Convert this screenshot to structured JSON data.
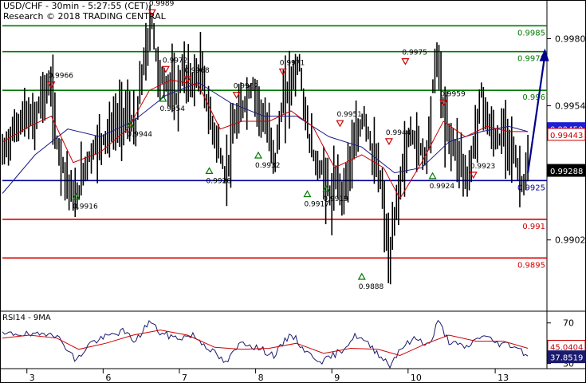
{
  "header": {
    "title": "USD/CHF - 30min - 5:27:55 (CET)",
    "copyright": "Research © 2018 TRADING CENTRAL"
  },
  "colors": {
    "candles": "#000000",
    "ma_fast": "#cc0000",
    "ma_slow": "#1a1a8c",
    "resistance": "#007a00",
    "support_blue": "#00009a",
    "support_red": "#d40000",
    "forecast_arrow": "#00008b",
    "price_label_blue": "#1f1fd6",
    "price_label_red": "#cc0000",
    "rsi_line": "#1a1a6e",
    "rsi_ma": "#cc0000",
    "up_marker": "#007a00",
    "down_marker": "#cc0000"
  },
  "chart_data": [
    {
      "type": "line",
      "name": "price",
      "ylim": [
        0.9875,
        0.9995
      ],
      "y_ticks": [
        "0.9980",
        "0.9954",
        "0.9928",
        "0.9902"
      ],
      "x_ticks": [
        "3",
        "6",
        "7",
        "8",
        "9",
        "10",
        "13"
      ],
      "price_path": [
        {
          "t": 0.0,
          "v": 0.9935
        },
        {
          "t": 0.02,
          "v": 0.9944
        },
        {
          "t": 0.04,
          "v": 0.995
        },
        {
          "t": 0.06,
          "v": 0.9948
        },
        {
          "t": 0.07,
          "v": 0.9957
        },
        {
          "t": 0.09,
          "v": 0.9962
        },
        {
          "t": 0.1,
          "v": 0.994
        },
        {
          "t": 0.12,
          "v": 0.9925
        },
        {
          "t": 0.135,
          "v": 0.9916
        },
        {
          "t": 0.15,
          "v": 0.993
        },
        {
          "t": 0.17,
          "v": 0.9938
        },
        {
          "t": 0.19,
          "v": 0.9942
        },
        {
          "t": 0.21,
          "v": 0.9948
        },
        {
          "t": 0.23,
          "v": 0.9951
        },
        {
          "t": 0.245,
          "v": 0.9944
        },
        {
          "t": 0.255,
          "v": 0.9965
        },
        {
          "t": 0.265,
          "v": 0.9975
        },
        {
          "t": 0.275,
          "v": 0.9988
        },
        {
          "t": 0.285,
          "v": 0.9968
        },
        {
          "t": 0.3,
          "v": 0.9962
        },
        {
          "t": 0.31,
          "v": 0.9962
        },
        {
          "t": 0.32,
          "v": 0.9956
        },
        {
          "t": 0.33,
          "v": 0.9967
        },
        {
          "t": 0.35,
          "v": 0.9963
        },
        {
          "t": 0.365,
          "v": 0.9968
        },
        {
          "t": 0.38,
          "v": 0.995
        },
        {
          "t": 0.395,
          "v": 0.994
        },
        {
          "t": 0.41,
          "v": 0.9926
        },
        {
          "t": 0.425,
          "v": 0.9945
        },
        {
          "t": 0.445,
          "v": 0.9955
        },
        {
          "t": 0.46,
          "v": 0.9962
        },
        {
          "t": 0.48,
          "v": 0.9948
        },
        {
          "t": 0.495,
          "v": 0.994
        },
        {
          "t": 0.5,
          "v": 0.9932
        },
        {
          "t": 0.515,
          "v": 0.9955
        },
        {
          "t": 0.53,
          "v": 0.9963
        },
        {
          "t": 0.545,
          "v": 0.9971
        },
        {
          "t": 0.56,
          "v": 0.9945
        },
        {
          "t": 0.575,
          "v": 0.9932
        },
        {
          "t": 0.59,
          "v": 0.9928
        },
        {
          "t": 0.605,
          "v": 0.9917
        },
        {
          "t": 0.615,
          "v": 0.9928
        },
        {
          "t": 0.625,
          "v": 0.9919
        },
        {
          "t": 0.635,
          "v": 0.993
        },
        {
          "t": 0.65,
          "v": 0.994
        },
        {
          "t": 0.665,
          "v": 0.9951
        },
        {
          "t": 0.68,
          "v": 0.9935
        },
        {
          "t": 0.695,
          "v": 0.9925
        },
        {
          "t": 0.705,
          "v": 0.9905
        },
        {
          "t": 0.712,
          "v": 0.9892
        },
        {
          "t": 0.72,
          "v": 0.991
        },
        {
          "t": 0.735,
          "v": 0.993
        },
        {
          "t": 0.75,
          "v": 0.9944
        },
        {
          "t": 0.765,
          "v": 0.9938
        },
        {
          "t": 0.78,
          "v": 0.9935
        },
        {
          "t": 0.79,
          "v": 0.996
        },
        {
          "t": 0.8,
          "v": 0.9975
        },
        {
          "t": 0.81,
          "v": 0.995
        },
        {
          "t": 0.825,
          "v": 0.994
        },
        {
          "t": 0.84,
          "v": 0.9935
        },
        {
          "t": 0.855,
          "v": 0.9924
        },
        {
          "t": 0.87,
          "v": 0.9945
        },
        {
          "t": 0.88,
          "v": 0.9959
        },
        {
          "t": 0.895,
          "v": 0.9945
        },
        {
          "t": 0.91,
          "v": 0.994
        },
        {
          "t": 0.925,
          "v": 0.9945
        },
        {
          "t": 0.94,
          "v": 0.9935
        },
        {
          "t": 0.955,
          "v": 0.9923
        },
        {
          "t": 0.965,
          "v": 0.9929
        }
      ],
      "ma_fast_path": [
        {
          "t": 0.0,
          "v": 0.994
        },
        {
          "t": 0.05,
          "v": 0.9946
        },
        {
          "t": 0.09,
          "v": 0.995
        },
        {
          "t": 0.13,
          "v": 0.9932
        },
        {
          "t": 0.18,
          "v": 0.9936
        },
        {
          "t": 0.23,
          "v": 0.9945
        },
        {
          "t": 0.27,
          "v": 0.996
        },
        {
          "t": 0.31,
          "v": 0.9964
        },
        {
          "t": 0.36,
          "v": 0.9962
        },
        {
          "t": 0.4,
          "v": 0.9945
        },
        {
          "t": 0.44,
          "v": 0.9948
        },
        {
          "t": 0.49,
          "v": 0.9948
        },
        {
          "t": 0.53,
          "v": 0.9952
        },
        {
          "t": 0.57,
          "v": 0.9946
        },
        {
          "t": 0.61,
          "v": 0.993
        },
        {
          "t": 0.66,
          "v": 0.9935
        },
        {
          "t": 0.7,
          "v": 0.993
        },
        {
          "t": 0.73,
          "v": 0.9918
        },
        {
          "t": 0.77,
          "v": 0.9932
        },
        {
          "t": 0.81,
          "v": 0.9948
        },
        {
          "t": 0.85,
          "v": 0.9942
        },
        {
          "t": 0.89,
          "v": 0.9946
        },
        {
          "t": 0.93,
          "v": 0.9944
        },
        {
          "t": 0.965,
          "v": 0.9944
        }
      ],
      "ma_slow_path": [
        {
          "t": 0.0,
          "v": 0.992
        },
        {
          "t": 0.06,
          "v": 0.9935
        },
        {
          "t": 0.12,
          "v": 0.9945
        },
        {
          "t": 0.18,
          "v": 0.9942
        },
        {
          "t": 0.24,
          "v": 0.9948
        },
        {
          "t": 0.3,
          "v": 0.9958
        },
        {
          "t": 0.36,
          "v": 0.9963
        },
        {
          "t": 0.42,
          "v": 0.9955
        },
        {
          "t": 0.48,
          "v": 0.995
        },
        {
          "t": 0.54,
          "v": 0.995
        },
        {
          "t": 0.6,
          "v": 0.9942
        },
        {
          "t": 0.66,
          "v": 0.9938
        },
        {
          "t": 0.72,
          "v": 0.9928
        },
        {
          "t": 0.77,
          "v": 0.993
        },
        {
          "t": 0.82,
          "v": 0.994
        },
        {
          "t": 0.88,
          "v": 0.9944
        },
        {
          "t": 0.93,
          "v": 0.9946
        },
        {
          "t": 0.965,
          "v": 0.9944
        }
      ],
      "levels": [
        {
          "value": 0.9985,
          "label": "0.9985",
          "color": "#007a00"
        },
        {
          "value": 0.9975,
          "label": "0.9975",
          "color": "#007a00"
        },
        {
          "value": 0.996,
          "label": "0.996",
          "color": "#007a00"
        },
        {
          "value": 0.9925,
          "label": "0.9925",
          "color": "#00009a"
        },
        {
          "value": 0.991,
          "label": "0.991",
          "color": "#d40000"
        },
        {
          "value": 0.9895,
          "label": "0.9895",
          "color": "#d40000"
        }
      ],
      "price_labels": [
        {
          "label": "0.99450",
          "value": 0.9945,
          "color": "#1f1fd6"
        },
        {
          "label": "0.99443",
          "value": 0.99443,
          "color": "#cc0000"
        },
        {
          "label": "0.99288",
          "value": 0.99288,
          "color": "#000000"
        }
      ],
      "markers": [
        {
          "kind": "down",
          "t": 0.09,
          "v": 0.9962,
          "label": "0.9966"
        },
        {
          "kind": "down",
          "t": 0.275,
          "v": 0.999,
          "label": "0.9989"
        },
        {
          "kind": "down",
          "t": 0.3,
          "v": 0.9968,
          "label": "0.9972"
        },
        {
          "kind": "down",
          "t": 0.34,
          "v": 0.9964,
          "label": "0.9968"
        },
        {
          "kind": "down",
          "t": 0.43,
          "v": 0.9958,
          "label": "0.9962"
        },
        {
          "kind": "down",
          "t": 0.515,
          "v": 0.9967,
          "label": "0.9971"
        },
        {
          "kind": "down",
          "t": 0.62,
          "v": 0.9947,
          "label": "0.9951"
        },
        {
          "kind": "down",
          "t": 0.71,
          "v": 0.994,
          "label": "0.9944"
        },
        {
          "kind": "down",
          "t": 0.74,
          "v": 0.9971,
          "label": "0.9975"
        },
        {
          "kind": "down",
          "t": 0.81,
          "v": 0.9955,
          "label": "0.9959"
        },
        {
          "kind": "up",
          "t": 0.135,
          "v": 0.9919,
          "label": "0.9916"
        },
        {
          "kind": "up",
          "t": 0.235,
          "v": 0.9947,
          "label": "0.9944"
        },
        {
          "kind": "up",
          "t": 0.295,
          "v": 0.9957,
          "label": "0.9954"
        },
        {
          "kind": "up",
          "t": 0.38,
          "v": 0.9929,
          "label": "0.9926"
        },
        {
          "kind": "up",
          "t": 0.47,
          "v": 0.9935,
          "label": "0.9932"
        },
        {
          "kind": "up",
          "t": 0.56,
          "v": 0.992,
          "label": "0.9917"
        },
        {
          "kind": "up",
          "t": 0.595,
          "v": 0.9922,
          "label": "0.9919"
        },
        {
          "kind": "up",
          "t": 0.66,
          "v": 0.9888,
          "label": "0.9888"
        },
        {
          "kind": "up",
          "t": 0.79,
          "v": 0.9927,
          "label": "0.9924"
        },
        {
          "kind": "down",
          "t": 0.865,
          "v": 0.9927,
          "label": "0.9923"
        }
      ],
      "forecast": {
        "from_t": 0.965,
        "from_v": 0.9928,
        "to_t": 0.995,
        "to_v": 0.9975
      }
    },
    {
      "type": "line",
      "name": "RSI14 - 9MA",
      "title": "RSI14 - 9MA",
      "ylim": [
        25,
        80
      ],
      "y_ticks": [
        "70",
        "50",
        "30"
      ],
      "current_values": [
        {
          "label": "45.0404",
          "value": 45.04,
          "color": "#cc0000"
        },
        {
          "label": "37.8519",
          "value": 37.85,
          "color": "#1a1a6e"
        }
      ],
      "rsi_path": [
        {
          "t": 0.0,
          "v": 58
        },
        {
          "t": 0.03,
          "v": 60
        },
        {
          "t": 0.06,
          "v": 57
        },
        {
          "t": 0.09,
          "v": 62
        },
        {
          "t": 0.12,
          "v": 45
        },
        {
          "t": 0.135,
          "v": 32
        },
        {
          "t": 0.16,
          "v": 50
        },
        {
          "t": 0.19,
          "v": 56
        },
        {
          "t": 0.22,
          "v": 62
        },
        {
          "t": 0.245,
          "v": 52
        },
        {
          "t": 0.27,
          "v": 72
        },
        {
          "t": 0.29,
          "v": 60
        },
        {
          "t": 0.32,
          "v": 55
        },
        {
          "t": 0.35,
          "v": 58
        },
        {
          "t": 0.38,
          "v": 45
        },
        {
          "t": 0.41,
          "v": 30
        },
        {
          "t": 0.44,
          "v": 52
        },
        {
          "t": 0.47,
          "v": 45
        },
        {
          "t": 0.5,
          "v": 38
        },
        {
          "t": 0.53,
          "v": 60
        },
        {
          "t": 0.56,
          "v": 40
        },
        {
          "t": 0.59,
          "v": 32
        },
        {
          "t": 0.62,
          "v": 42
        },
        {
          "t": 0.65,
          "v": 58
        },
        {
          "t": 0.68,
          "v": 45
        },
        {
          "t": 0.7,
          "v": 35
        },
        {
          "t": 0.712,
          "v": 28
        },
        {
          "t": 0.73,
          "v": 45
        },
        {
          "t": 0.76,
          "v": 55
        },
        {
          "t": 0.785,
          "v": 48
        },
        {
          "t": 0.8,
          "v": 72
        },
        {
          "t": 0.82,
          "v": 52
        },
        {
          "t": 0.85,
          "v": 45
        },
        {
          "t": 0.88,
          "v": 58
        },
        {
          "t": 0.91,
          "v": 50
        },
        {
          "t": 0.94,
          "v": 48
        },
        {
          "t": 0.965,
          "v": 38
        }
      ],
      "rsi_ma_path": [
        {
          "t": 0.0,
          "v": 55
        },
        {
          "t": 0.05,
          "v": 58
        },
        {
          "t": 0.1,
          "v": 55
        },
        {
          "t": 0.14,
          "v": 44
        },
        {
          "t": 0.19,
          "v": 50
        },
        {
          "t": 0.24,
          "v": 58
        },
        {
          "t": 0.29,
          "v": 63
        },
        {
          "t": 0.34,
          "v": 58
        },
        {
          "t": 0.39,
          "v": 46
        },
        {
          "t": 0.44,
          "v": 44
        },
        {
          "t": 0.49,
          "v": 45
        },
        {
          "t": 0.54,
          "v": 50
        },
        {
          "t": 0.59,
          "v": 40
        },
        {
          "t": 0.64,
          "v": 45
        },
        {
          "t": 0.69,
          "v": 44
        },
        {
          "t": 0.73,
          "v": 38
        },
        {
          "t": 0.78,
          "v": 50
        },
        {
          "t": 0.82,
          "v": 58
        },
        {
          "t": 0.87,
          "v": 52
        },
        {
          "t": 0.92,
          "v": 52
        },
        {
          "t": 0.965,
          "v": 45
        }
      ]
    }
  ]
}
